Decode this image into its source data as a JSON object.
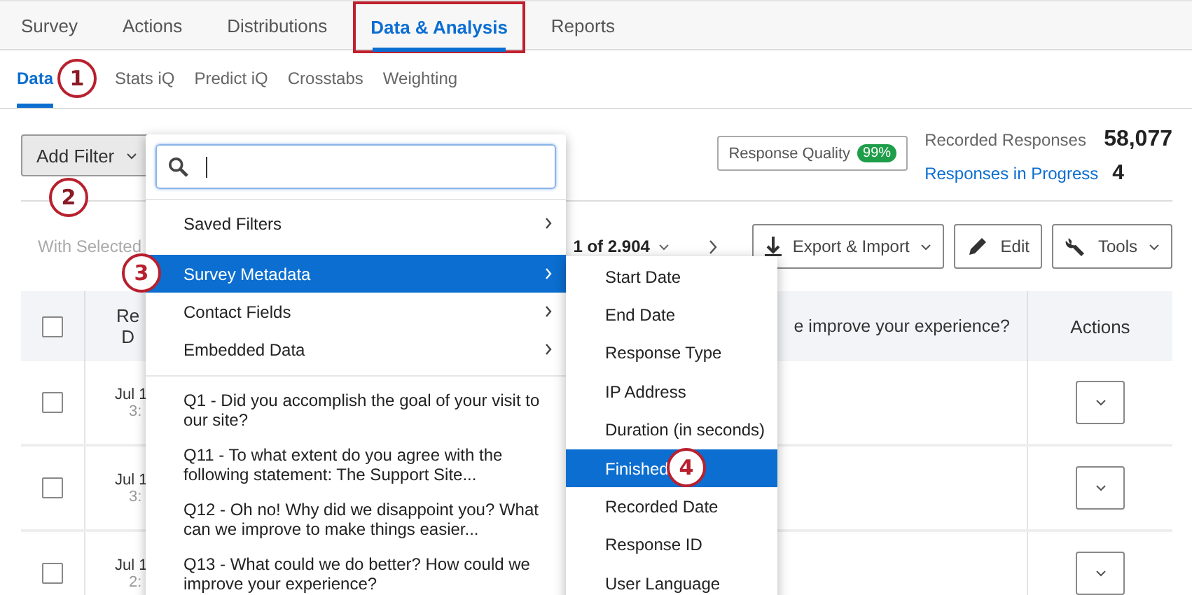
{
  "top_tabs": [
    {
      "label": "Survey",
      "selected": false,
      "outlined": false
    },
    {
      "label": "Actions",
      "selected": false,
      "outlined": false
    },
    {
      "label": "Distributions",
      "selected": false,
      "outlined": false
    },
    {
      "label": "Data & Analysis",
      "selected": true,
      "outlined": true
    },
    {
      "label": "Reports",
      "selected": false,
      "outlined": false
    }
  ],
  "sub_tabs": [
    {
      "label": "Data",
      "selected": true,
      "step": "1"
    },
    {
      "label": "Stats iQ",
      "selected": false
    },
    {
      "label": "Predict iQ",
      "selected": false
    },
    {
      "label": "Crosstabs",
      "selected": false
    },
    {
      "label": "Weighting",
      "selected": false
    }
  ],
  "add_filter_button": {
    "label": "Add Filter",
    "step": "2"
  },
  "response_quality": {
    "label": "Response Quality",
    "badge": "99%"
  },
  "recorded_responses": {
    "label": "Recorded Responses",
    "value": "58,077"
  },
  "responses_in_progress": {
    "label": "Responses in Progress",
    "value": "4"
  },
  "toolbar": {
    "with_selected": "With Selected",
    "pagination": "1 of 2.904",
    "buttons": [
      {
        "label": "Export & Import"
      },
      {
        "label": "Edit"
      },
      {
        "label": "Tools"
      }
    ]
  },
  "table": {
    "columns": [
      {
        "kind": "checkbox",
        "checked": false
      },
      {
        "kind": "text",
        "lines": [
          "Re",
          "D"
        ]
      },
      {
        "kind": "text",
        "lines": [
          "e improve your experience?"
        ]
      },
      {
        "kind": "text",
        "lines": [
          "Actions"
        ]
      }
    ],
    "rows": [
      {
        "date": "Jul 1",
        "time": "3:",
        "checked": false
      },
      {
        "date": "Jul 1",
        "time": "3:",
        "checked": false
      },
      {
        "date": "Jul 1",
        "time": "2:",
        "checked": false
      }
    ]
  },
  "filter_menu": {
    "items": [
      {
        "label": "Saved Filters",
        "kind": "submenu",
        "selected": false
      },
      {
        "label": "Survey Metadata",
        "kind": "submenu",
        "selected": true,
        "step": "3"
      },
      {
        "label": "Contact Fields",
        "kind": "submenu",
        "selected": false
      },
      {
        "label": "Embedded Data",
        "kind": "submenu",
        "selected": false
      },
      {
        "label": "Q1 - Did you accomplish the goal of your visit to our site?",
        "kind": "question",
        "selected": false
      },
      {
        "label": "Q11 - To what extent do you agree with the following statement: The Support Site...",
        "kind": "question",
        "selected": false
      },
      {
        "label": "Q12 - Oh no! Why did we disappoint you? What can we improve to make things easier...",
        "kind": "question",
        "selected": false
      },
      {
        "label": "Q13 - What could we do better? How could we improve your experience?",
        "kind": "question",
        "selected": false
      }
    ]
  },
  "metadata_submenu": {
    "items": [
      {
        "label": "Start Date",
        "selected": false
      },
      {
        "label": "End Date",
        "selected": false
      },
      {
        "label": "Response Type",
        "selected": false
      },
      {
        "label": "IP Address",
        "selected": false
      },
      {
        "label": "Duration (in seconds)",
        "selected": false
      },
      {
        "label": "Finished",
        "selected": true,
        "step": "4"
      },
      {
        "label": "Recorded Date",
        "selected": false
      },
      {
        "label": "Response ID",
        "selected": false
      },
      {
        "label": "User Language",
        "selected": false
      }
    ]
  }
}
